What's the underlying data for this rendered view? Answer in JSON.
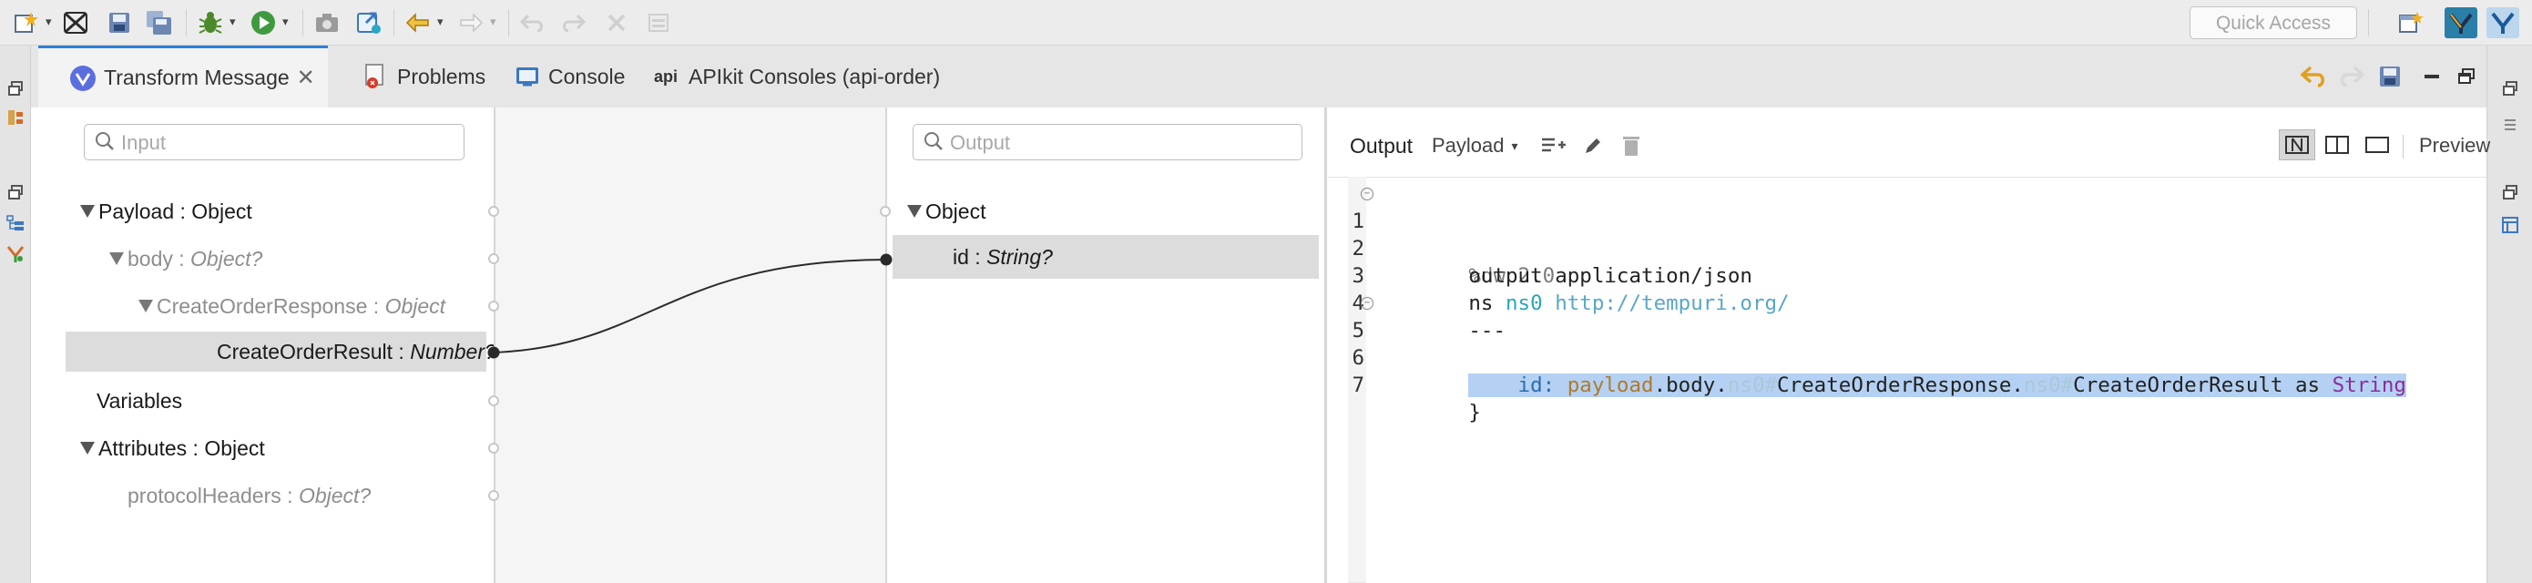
{
  "toolbar": {
    "quick_access_placeholder": "Quick Access",
    "icons": [
      "new-wizard-icon",
      "anypoint-icon",
      "save-icon",
      "save-all-icon",
      "debug-icon",
      "run-icon",
      "camera-icon",
      "deploy-icon",
      "back-icon",
      "forward-icon",
      "undo-icon",
      "redo-icon",
      "delete-icon",
      "window-icon"
    ]
  },
  "tabs": [
    {
      "label": "Transform Message",
      "active": true,
      "icon": "dataweave-icon"
    },
    {
      "label": "Problems",
      "active": false,
      "icon": "problems-icon"
    },
    {
      "label": "Console",
      "active": false,
      "icon": "console-icon"
    },
    {
      "label": "APIkit Consoles (api-order)",
      "active": false,
      "icon_text": "api"
    }
  ],
  "input_panel": {
    "search_placeholder": "Input",
    "tree": [
      {
        "name": "Payload",
        "type": "Object",
        "expanded": true
      },
      {
        "name": "body",
        "type": "Object?",
        "expanded": true
      },
      {
        "name": "CreateOrderResponse",
        "type": "Object",
        "expanded": true
      },
      {
        "name": "CreateOrderResult",
        "type": "Number?",
        "selected": true
      },
      {
        "name": "Variables"
      },
      {
        "name": "Attributes",
        "type": "Object",
        "expanded": true
      },
      {
        "name": "protocolHeaders",
        "type": "Object?"
      }
    ]
  },
  "output_panel": {
    "search_placeholder": "Output",
    "tree": [
      {
        "name": "Object",
        "expanded": true
      },
      {
        "name": "id",
        "type": "String?",
        "selected": true
      }
    ]
  },
  "script_panel": {
    "output_label": "Output",
    "target_label": "Payload",
    "preview_label": "Preview",
    "code_lines": [
      {
        "n": "1",
        "text": "%dw 2.0"
      },
      {
        "n": "2",
        "text": "output application/json"
      },
      {
        "n": "3",
        "text_a": "ns ",
        "text_b": "ns0 ",
        "text_c": "http://tempuri.org/"
      },
      {
        "n": "4",
        "text": "---"
      },
      {
        "n": "5",
        "text": "{"
      },
      {
        "n": "6",
        "p1": "    id: ",
        "p2": "payload",
        "p3": ".body.",
        "p4": "ns0#",
        "p5": "CreateOrderResponse.",
        "p6": "ns0#",
        "p7": "CreateOrderResult as ",
        "p8": "String"
      },
      {
        "n": "7",
        "text": "}"
      }
    ]
  },
  "colors": {
    "accent": "#2f7fd6",
    "selection": "#b4d1f3",
    "mapping_line": "#2a2a2a"
  }
}
